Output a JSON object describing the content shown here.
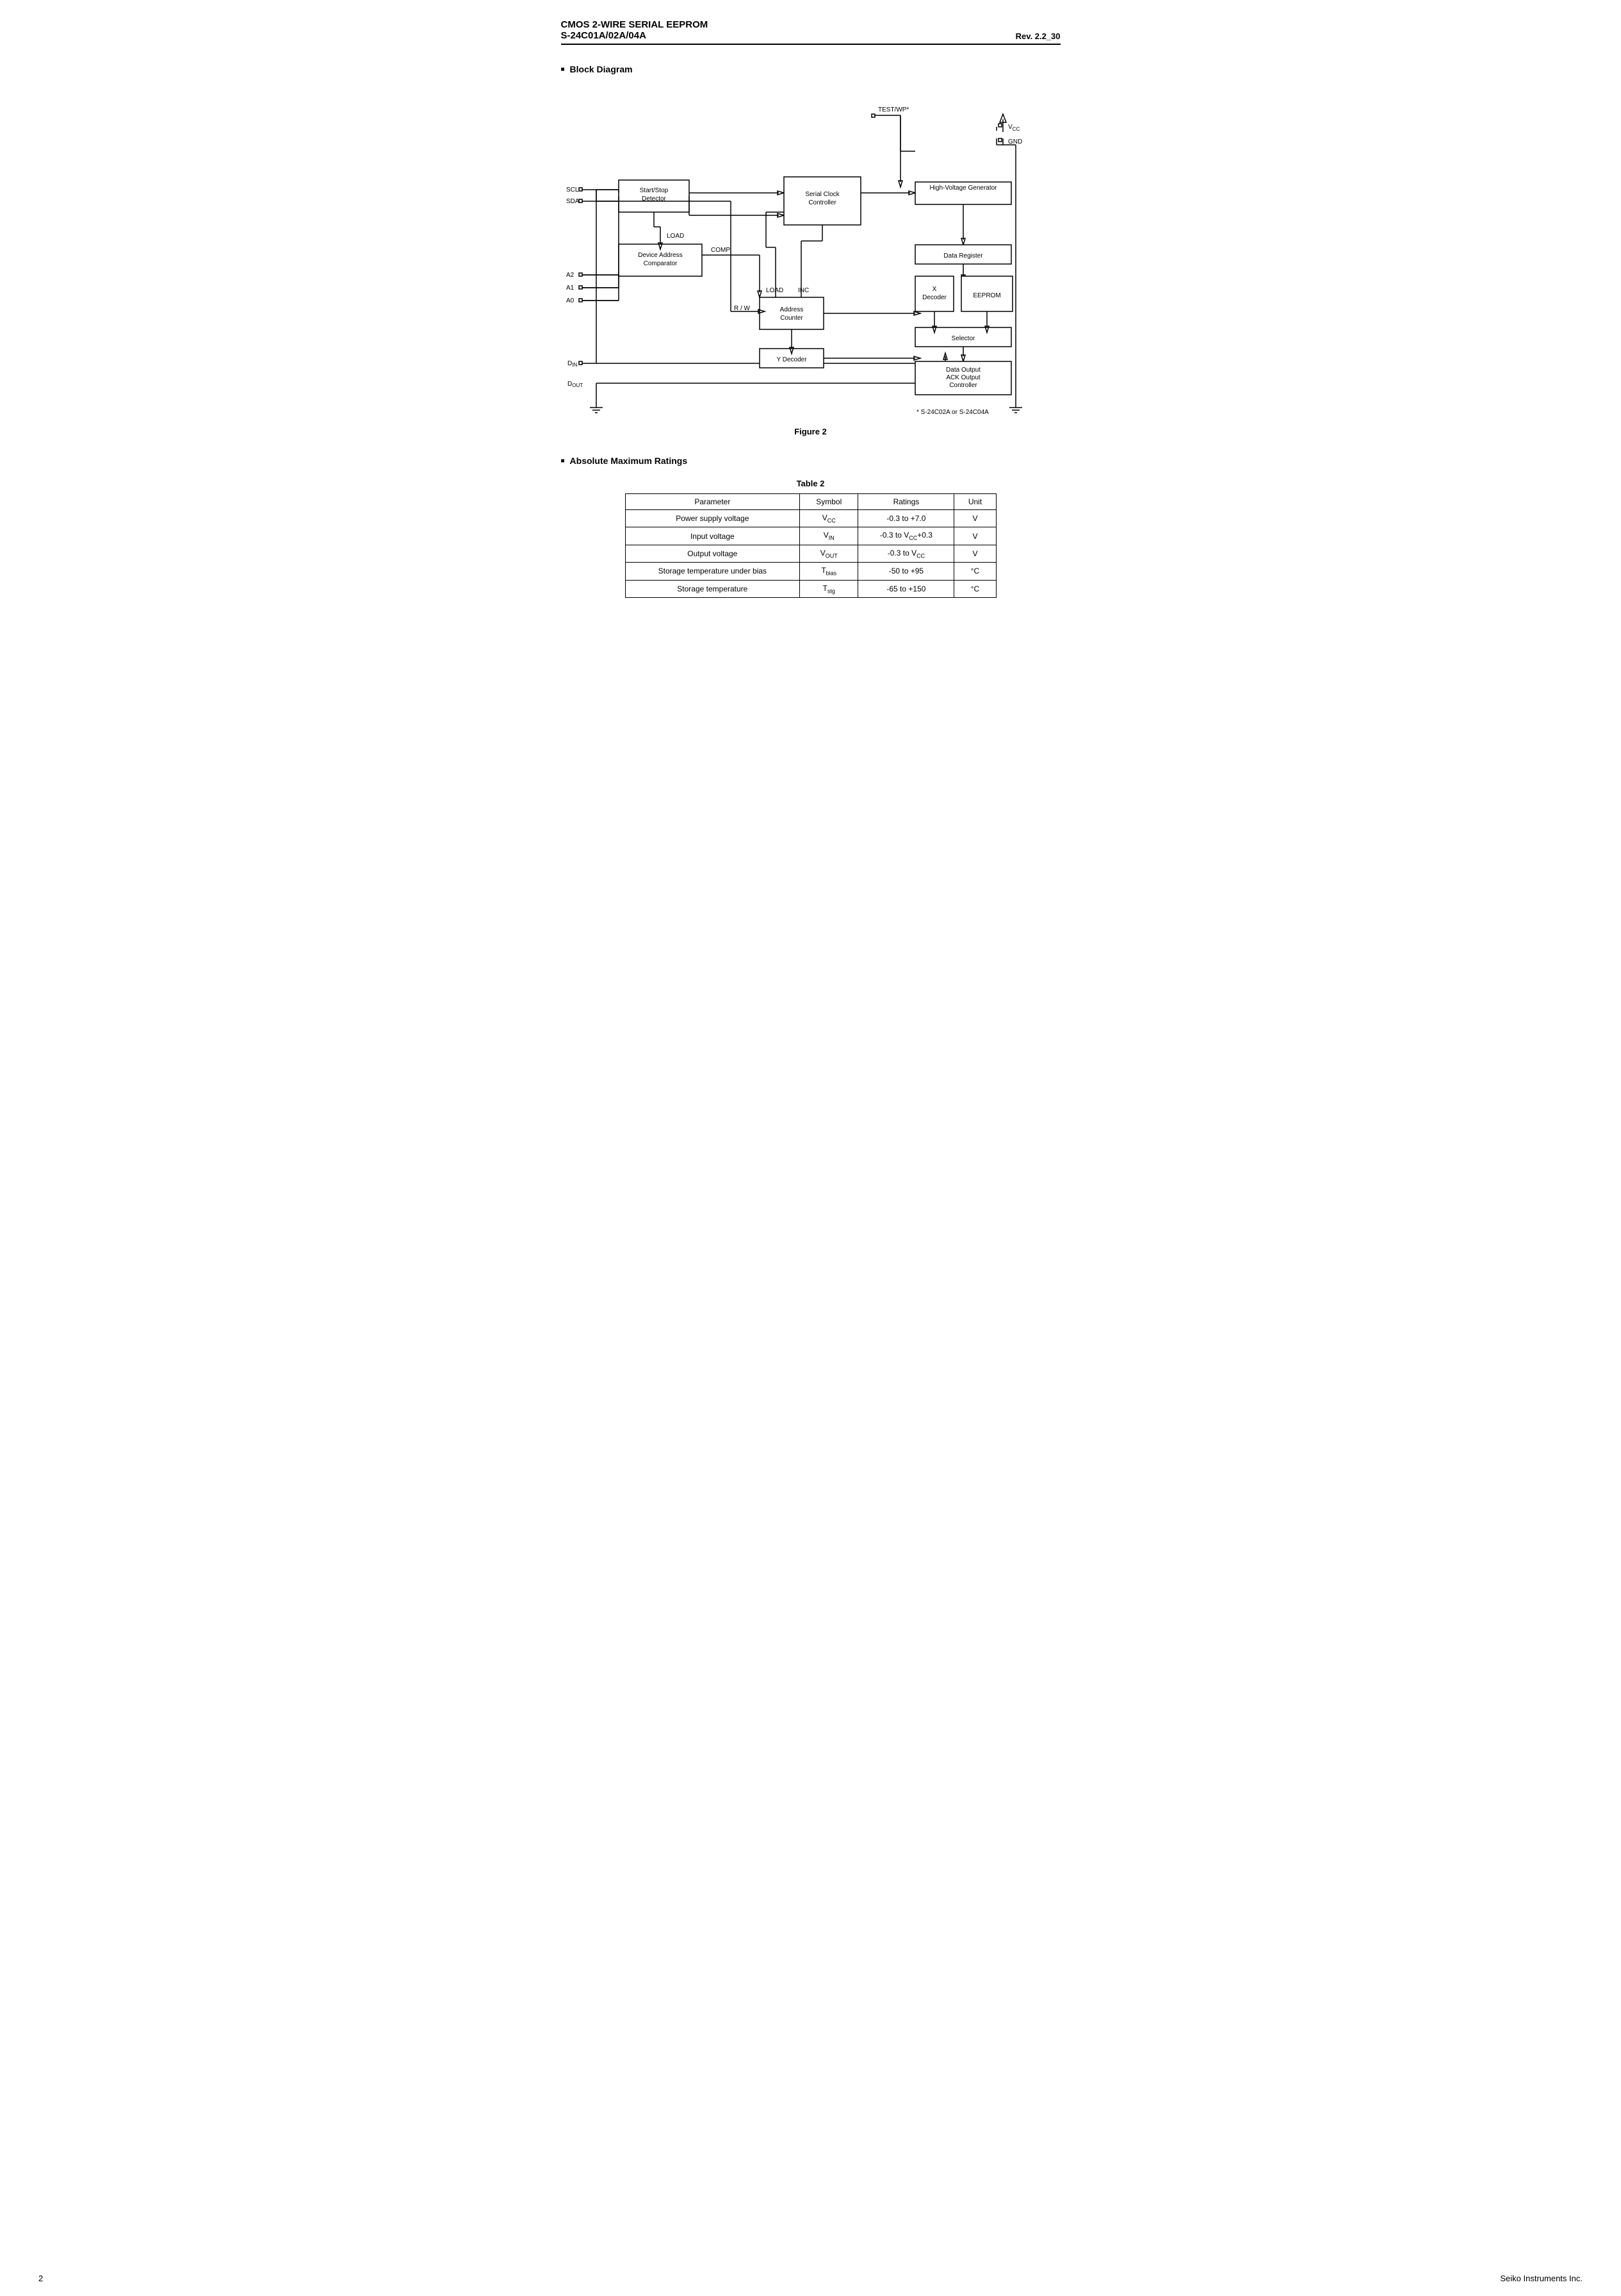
{
  "header": {
    "title_line1": "CMOS 2-WIRE SERIAL  EEPROM",
    "title_line2": "S-24C01A/02A/04A",
    "revision": "Rev. 2.2_30"
  },
  "block_diagram": {
    "section_heading": "Block Diagram",
    "figure_label": "Figure 2",
    "footnote": "*   S-24C02A or S-24C04A",
    "blocks": {
      "start_stop": "Start/Stop\nDetector",
      "serial_clock": "Serial Clock\nController",
      "high_voltage": "High-Voltage Generator",
      "device_address": "Device Address\nComparator",
      "address_counter": "Address\nCounter",
      "y_decoder": "Y Decoder",
      "x_decoder": "X\nDecoder",
      "eeprom": "EEPROM",
      "data_register": "Data Register",
      "selector": "Selector",
      "data_output": "Data Output\nACK Output\nController"
    },
    "pins": {
      "scl": "SCL",
      "sda": "SDA",
      "a2": "A2",
      "a1": "A1",
      "a0": "A0",
      "din": "Dᴵₙ",
      "dout": "Dₒᵁᵀ",
      "test_wp": "TEST/WP*",
      "vcc": "Vᶜᶜ",
      "gnd": "GND"
    },
    "labels": {
      "load1": "LOAD",
      "comp": "COMP",
      "load2": "LOAD",
      "inc": "INC",
      "rw": "R / W"
    }
  },
  "table": {
    "label": "Table  2",
    "headers": [
      "Parameter",
      "Symbol",
      "Ratings",
      "Unit"
    ],
    "rows": [
      [
        "Power supply voltage",
        "V_CC",
        "-0.3 to +7.0",
        "V"
      ],
      [
        "Input voltage",
        "V_IN",
        "-0.3 to V_CC+0.3",
        "V"
      ],
      [
        "Output voltage",
        "V_OUT",
        "-0.3 to V_CC",
        "V"
      ],
      [
        "Storage temperature under bias",
        "T_bias",
        "-50 to +95",
        "°C"
      ],
      [
        "Storage temperature",
        "T_stg",
        "-65 to +150",
        "°C"
      ]
    ]
  },
  "absolute_ratings": {
    "section_heading": "Absolute Maximum Ratings"
  },
  "footer": {
    "page_number": "2",
    "company": "Seiko Instruments Inc."
  }
}
